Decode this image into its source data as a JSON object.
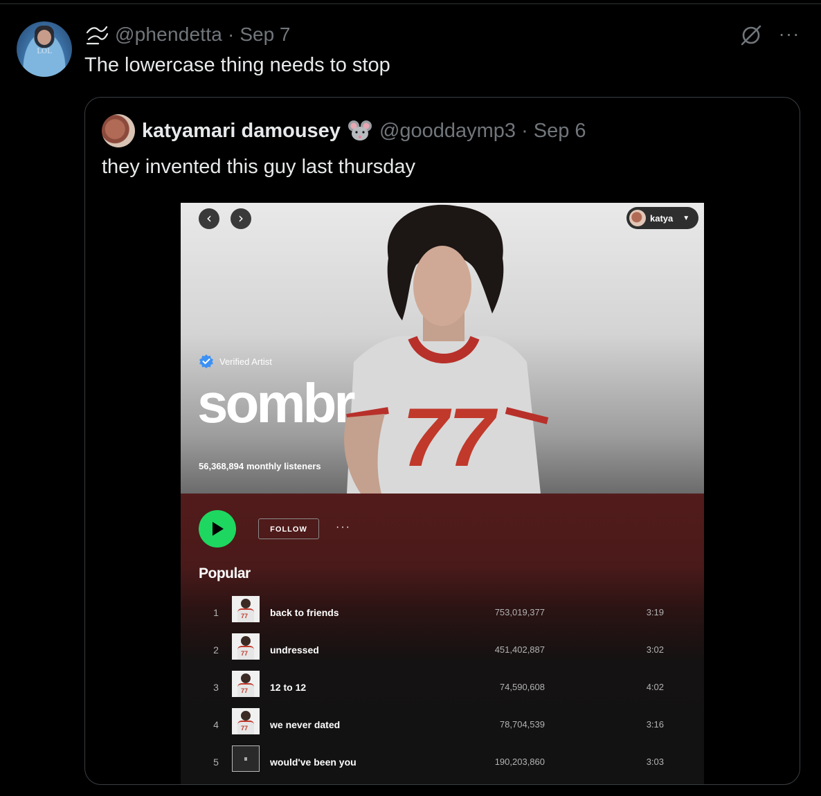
{
  "tweet": {
    "handle": "@phendetta",
    "date": "Sep 7",
    "text": "The lowercase thing needs to stop",
    "avatar_text": "LOL"
  },
  "quote": {
    "display_name": "katyamari damousey",
    "handle": "@gooddaymp3",
    "date": "Sep 6",
    "text": "they invented this guy last thursday"
  },
  "spotify": {
    "user_name": "katya",
    "verified_label": "Verified Artist",
    "artist_name": "sombr",
    "monthly_listeners": "56,368,894",
    "listeners_suffix": "monthly listeners",
    "follow_label": "FOLLOW",
    "more_label": "···",
    "popular_heading": "Popular",
    "jersey_number": "77",
    "tracks": [
      {
        "num": "1",
        "title": "back to friends",
        "plays": "753,019,377",
        "duration": "3:19"
      },
      {
        "num": "2",
        "title": "undressed",
        "plays": "451,402,887",
        "duration": "3:02"
      },
      {
        "num": "3",
        "title": "12 to 12",
        "plays": "74,590,608",
        "duration": "4:02"
      },
      {
        "num": "4",
        "title": "we never dated",
        "plays": "78,704,539",
        "duration": "3:16"
      },
      {
        "num": "5",
        "title": "would've been you",
        "plays": "190,203,860",
        "duration": "3:03"
      }
    ]
  },
  "colors": {
    "background": "#000000",
    "text_primary": "#e7e9ea",
    "text_secondary": "#71767b",
    "card_border": "#3a3f44",
    "spotify_green": "#1ed760",
    "spotify_maroon": "#531b1b",
    "verified_blue": "#3d91f4"
  },
  "icons": {
    "nav_back": "‹",
    "nav_forward": "›",
    "caret": "▼",
    "more": "···"
  }
}
